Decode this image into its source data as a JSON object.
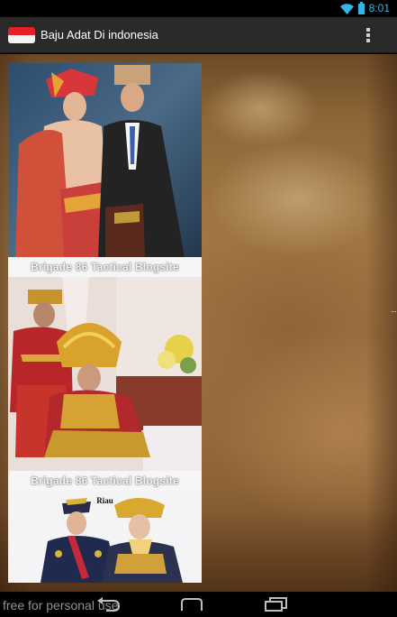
{
  "status_bar": {
    "time": "8:01",
    "accent_color": "#33b5e5",
    "icons": [
      "wifi-icon",
      "battery-icon"
    ]
  },
  "action_bar": {
    "title": "Baju Adat Di indonesia",
    "flag_icon": "indonesia-flag-icon",
    "menu_icon": "overflow-menu-icon",
    "background": "#2a2a2a"
  },
  "gallery": {
    "items": [
      {
        "watermark": "Brigade 86 Tactical Blogsite"
      },
      {
        "watermark": "Brigade 86 Tactical Blogsite"
      },
      {
        "label": "Riau"
      }
    ]
  },
  "navigation_bar": {
    "icons": [
      "back-icon",
      "home-icon",
      "recents-icon"
    ]
  },
  "overlay": {
    "text": "free for personal use"
  }
}
